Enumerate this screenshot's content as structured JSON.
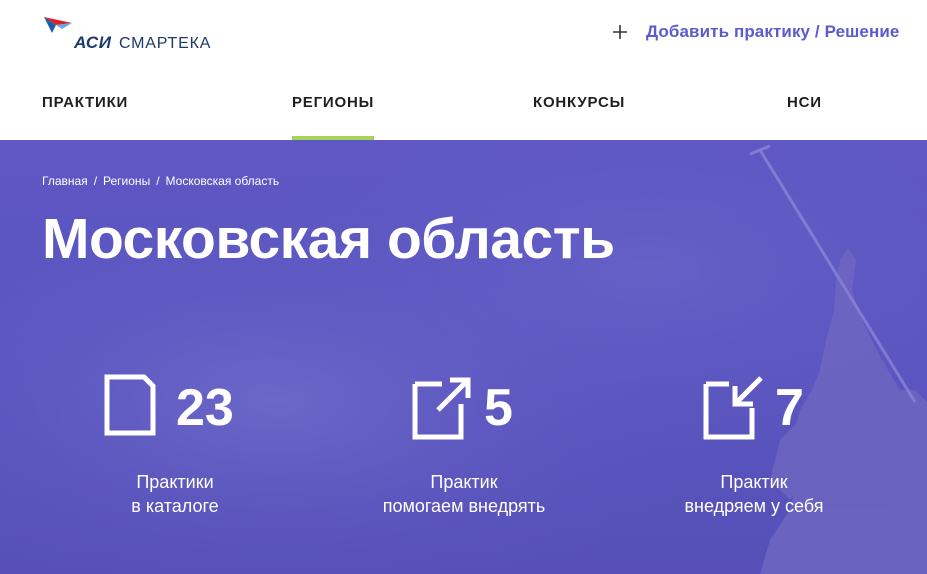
{
  "header": {
    "logo_mark": "АСИ",
    "logo_name": "СМАРТЕКА",
    "add_label": "Добавить практику / Решение"
  },
  "nav": {
    "items": [
      {
        "label": "ПРАКТИКИ",
        "active": false
      },
      {
        "label": "РЕГИОНЫ",
        "active": true
      },
      {
        "label": "КОНКУРСЫ",
        "active": false
      },
      {
        "label": "НСИ",
        "active": false
      }
    ]
  },
  "breadcrumb": {
    "items": [
      "Главная",
      "Регионы",
      "Московская область"
    ],
    "separator": "/"
  },
  "page_title": "Московская область",
  "stats": [
    {
      "icon": "document-icon",
      "value": "23",
      "label_line1": "Практики",
      "label_line2": "в каталоге"
    },
    {
      "icon": "document-export-icon",
      "value": "5",
      "label_line1": "Практик",
      "label_line2": "помогаем внедрять"
    },
    {
      "icon": "document-import-icon",
      "value": "7",
      "label_line1": "Практик",
      "label_line2": "внедряем у себя"
    }
  ],
  "colors": {
    "hero_bg": "#5a55c0",
    "accent_link": "#5b5bcf",
    "nav_active_underline": "#a6d35a",
    "logo": "#1b3a6b"
  }
}
